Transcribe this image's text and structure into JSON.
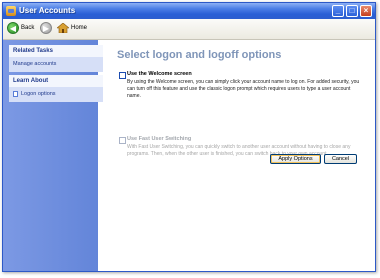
{
  "window": {
    "title": "User Accounts"
  },
  "toolbar": {
    "back_label": "Back",
    "home_label": "Home"
  },
  "sidebar": {
    "related_tasks": {
      "header": "Related Tasks",
      "items": [
        "Manage accounts"
      ]
    },
    "learn_about": {
      "header": "Learn About",
      "items": [
        "Logon options"
      ]
    }
  },
  "main": {
    "heading": "Select logon and logoff options",
    "options": [
      {
        "label": "Use the Welcome screen",
        "checked": false,
        "enabled": true,
        "description": "By using the Welcome screen, you can simply click your account name to log on. For added security, you can turn off this feature and use the classic logon prompt which requires users to type a user account name."
      },
      {
        "label": "Use Fast User Switching",
        "checked": false,
        "enabled": false,
        "description": "With Fast User Switching, you can quickly switch to another user account without having to close any programs. Then, when the other user is finished, you can switch back to your own account."
      }
    ],
    "apply_label": "Apply Options",
    "cancel_label": "Cancel"
  },
  "colors": {
    "title_bar": "#2a5fd6",
    "sidebar": "#7c99e4",
    "heading": "#7f95b8"
  }
}
